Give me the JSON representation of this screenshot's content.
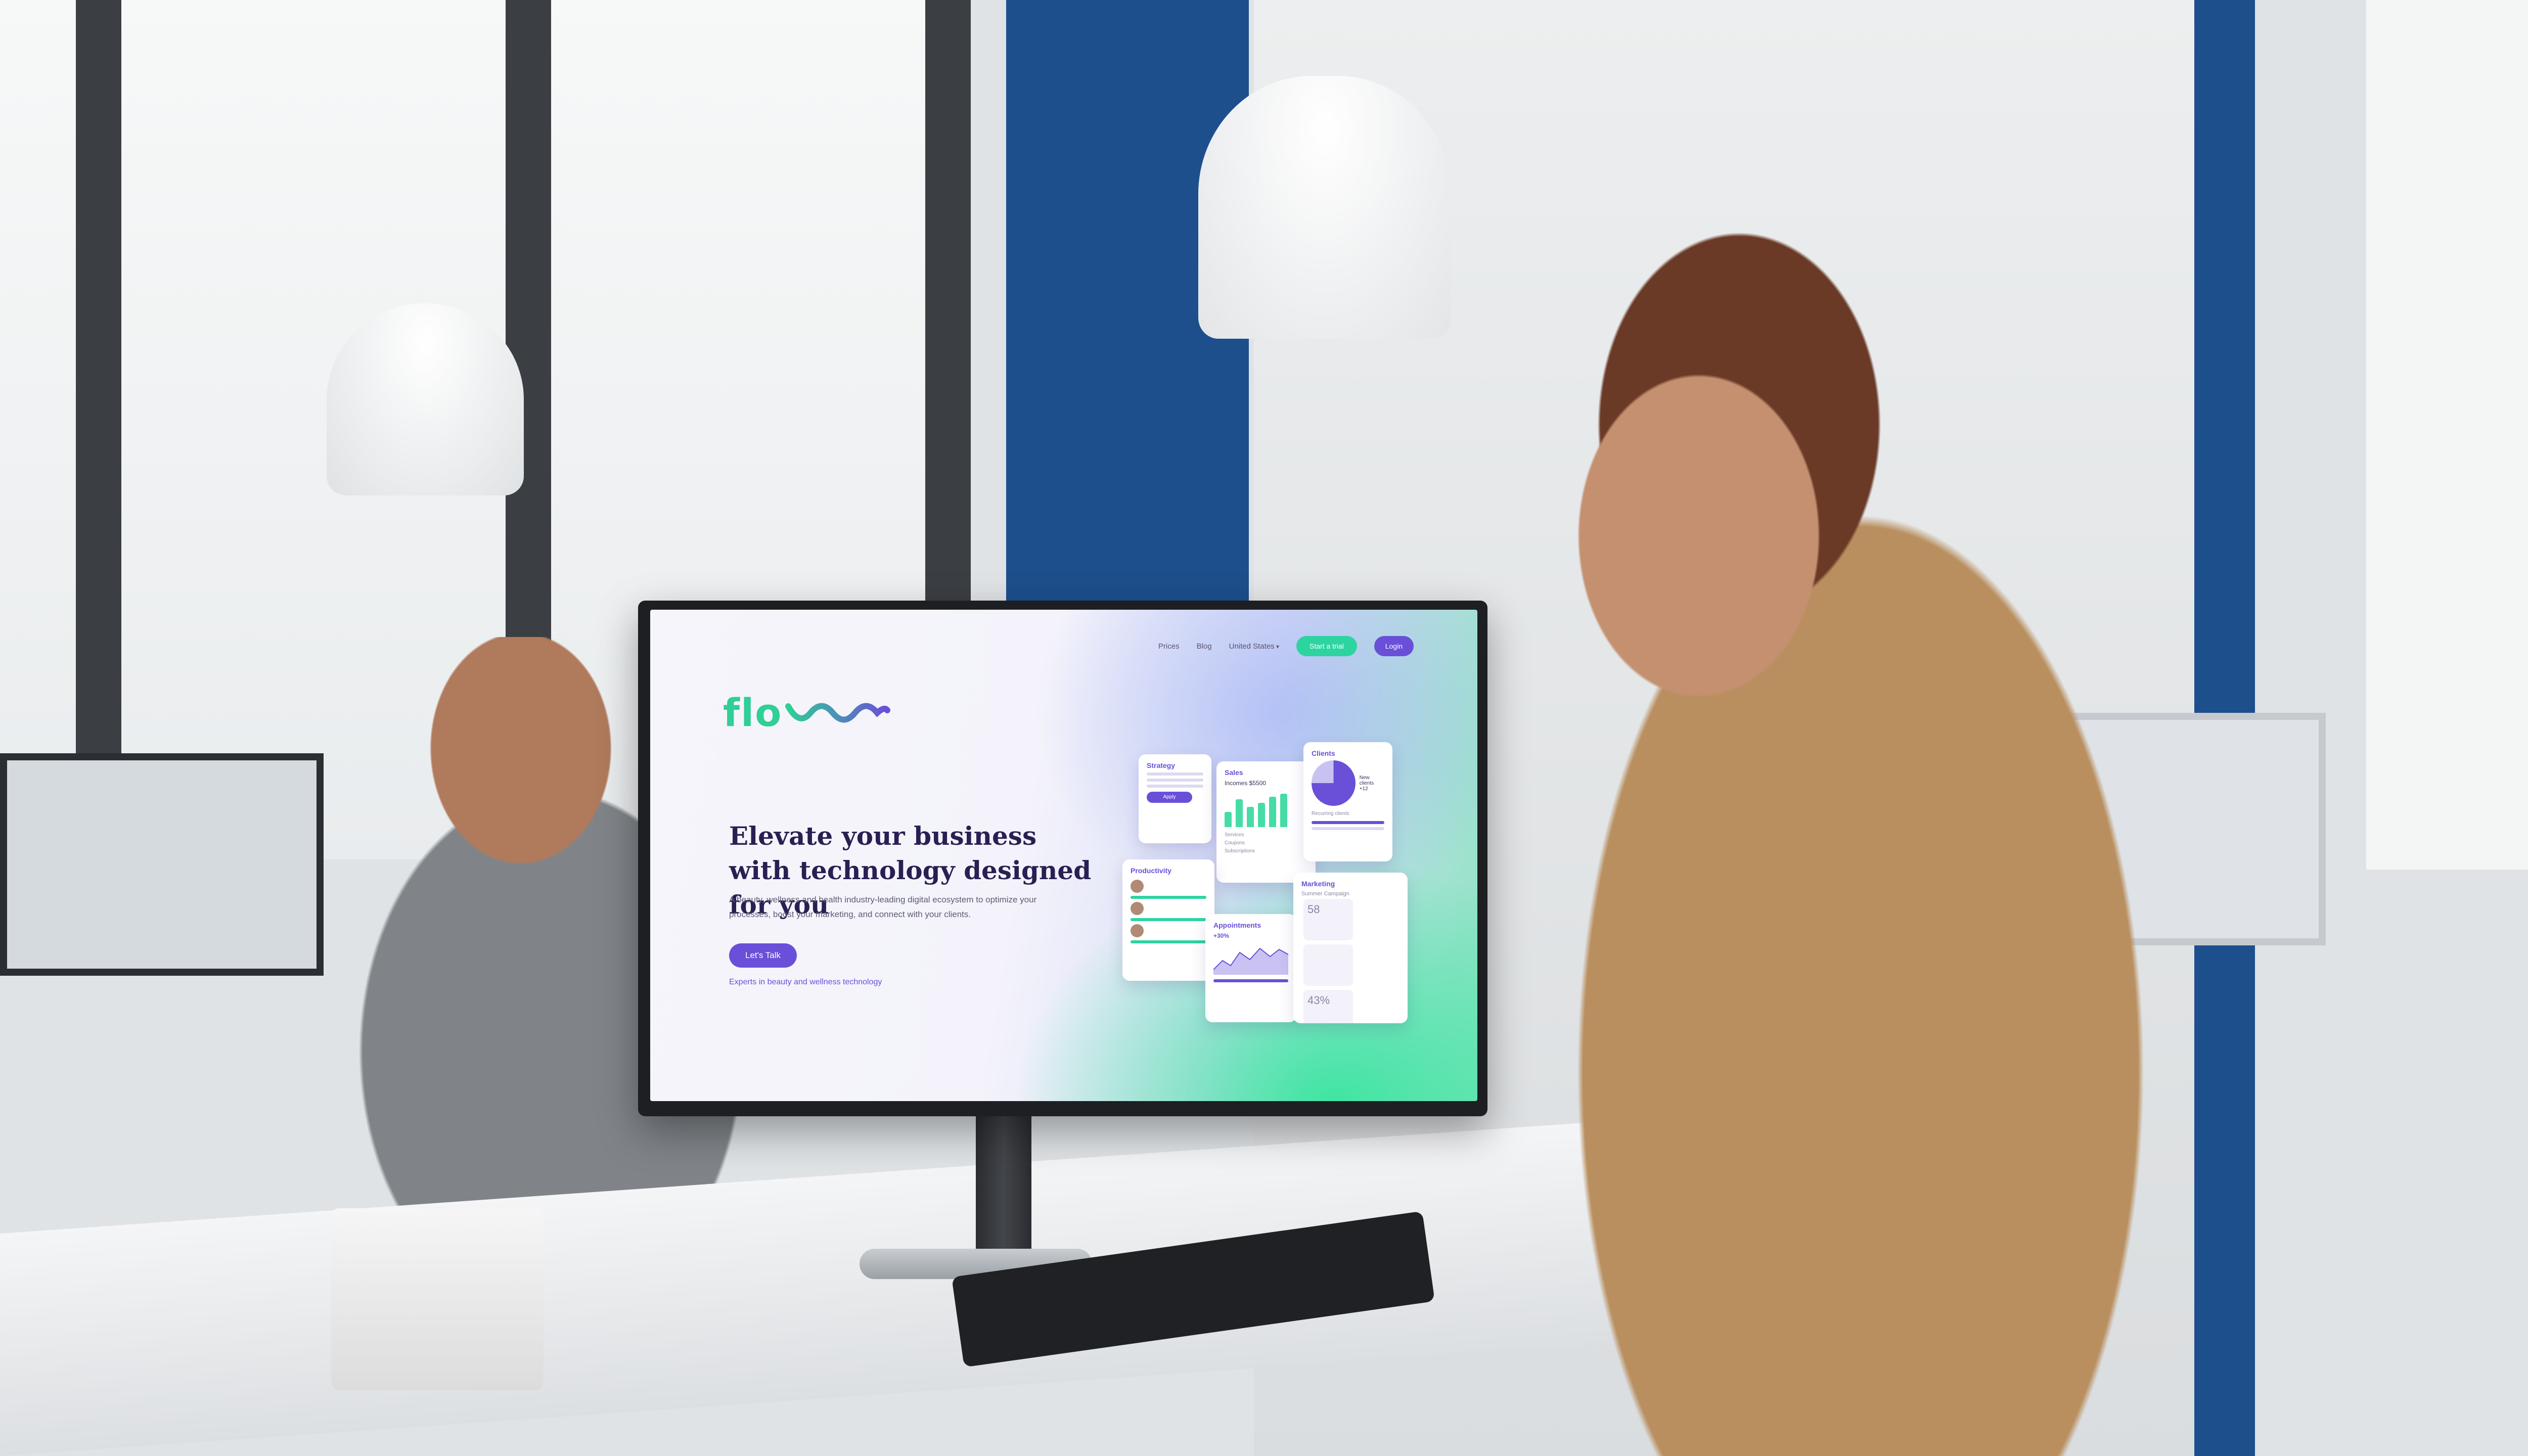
{
  "nav": {
    "prices": "Prices",
    "blog": "Blog",
    "country": "United States",
    "start_trial": "Start a trial",
    "login": "Login"
  },
  "brand": {
    "logo_text": "flo",
    "accent": "#2fcf96",
    "purple": "#6a4fd8"
  },
  "hero": {
    "title": "Elevate your business with technology designed for you",
    "subtitle": "A beauty, wellness and health industry-leading digital ecosystem to optimize your processes, boost your marketing, and connect with your clients.",
    "cta": "Let's Talk",
    "tagline": "Experts in beauty and wellness technology"
  },
  "cards": {
    "strategy": {
      "title": "Strategy",
      "button": "Apply"
    },
    "sales": {
      "title": "Sales",
      "income": "Incomes $5500",
      "legend": [
        "Services",
        "Coupons",
        "Subscriptions"
      ]
    },
    "clients": {
      "title": "Clients",
      "new_label": "New clients",
      "new_value": "+12",
      "recurring": "Recurring clients"
    },
    "productivity": {
      "title": "Productivity"
    },
    "appointments": {
      "title": "Appointments",
      "value": "+30%"
    },
    "marketing": {
      "title": "Marketing",
      "subtitle": "Summer Campaign",
      "stat1": "58",
      "stat2": "43%"
    }
  }
}
